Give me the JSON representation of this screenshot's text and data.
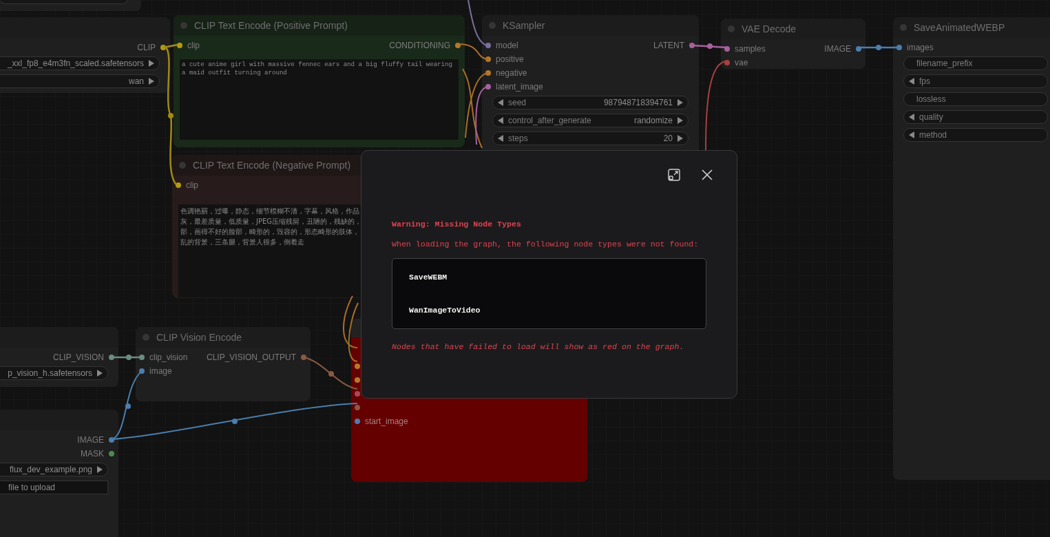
{
  "canvas": {
    "nodes": [
      {
        "kind": "default",
        "outputs": [
          {
            "label": "CLIP",
            "color": "#b49a12"
          }
        ],
        "widgets": [
          {
            "kind": "combo",
            "value": "_xxl_fp8_e4m3fn_scaled.safetensors"
          },
          {
            "kind": "combo",
            "value": "wan"
          }
        ]
      },
      {
        "kind": "positive",
        "title": "CLIP Text Encode (Positive Prompt)",
        "inputs": [
          {
            "label": "clip",
            "color": "#b49a12"
          }
        ],
        "outputs": [
          {
            "label": "CONDITIONING",
            "color": "#b8782a"
          }
        ],
        "prompt": "a cute anime girl with massive fennec ears and a big fluffy tail wearing a maid outfit turning around"
      },
      {
        "kind": "negative",
        "title": "CLIP Text Encode (Negative Prompt)",
        "inputs": [
          {
            "label": "clip",
            "color": "#b49a12"
          }
        ],
        "prompt_lines": [
          "色调艳丽，过曝，静态，细节模糊不清，字幕，风格，作品",
          "灰，最差质量，低质量，JPEG压缩残留，丑陋的，残缺的，",
          "部，画得不好的脸部，畸形的，毁容的，形态畸形的肢体，",
          "乱的背景，三条腿，背景人很多，倒着走"
        ]
      },
      {
        "kind": "default",
        "title": "KSampler",
        "inputs": [
          {
            "label": "model",
            "color": "#7a6f9c"
          },
          {
            "label": "positive",
            "color": "#b8782a"
          },
          {
            "label": "negative",
            "color": "#b8782a"
          },
          {
            "label": "latent_image",
            "color": "#a8609e"
          }
        ],
        "outputs": [
          {
            "label": "LATENT",
            "color": "#a8609e"
          }
        ],
        "widgets": [
          {
            "kind": "number",
            "label": "seed",
            "value": "987948718394761"
          },
          {
            "kind": "combo",
            "label": "control_after_generate",
            "value": "randomize"
          },
          {
            "kind": "number",
            "label": "steps",
            "value": "20"
          }
        ]
      },
      {
        "kind": "default",
        "title": "VAE Decode",
        "inputs": [
          {
            "label": "samples",
            "color": "#a8609e"
          },
          {
            "label": "vae",
            "color": "#a84040"
          }
        ],
        "outputs": [
          {
            "label": "IMAGE",
            "color": "#4a7eae"
          }
        ]
      },
      {
        "kind": "default",
        "title": "SaveAnimatedWEBP",
        "inputs": [
          {
            "label": "images",
            "color": "#4a7eae"
          }
        ],
        "widgets": [
          {
            "kind": "text",
            "label": "filename_prefix"
          },
          {
            "kind": "number",
            "label": "fps"
          },
          {
            "kind": "toggle",
            "label": "lossless"
          },
          {
            "kind": "number",
            "label": "quality"
          },
          {
            "kind": "combo",
            "label": "method"
          }
        ]
      },
      {
        "kind": "default",
        "outputs": [
          {
            "label": "CLIP_VISION",
            "color": "#6a8c82"
          }
        ],
        "widgets": [
          {
            "kind": "combo",
            "value": "p_vision_h.safetensors"
          }
        ]
      },
      {
        "kind": "default",
        "title": "CLIP Vision Encode",
        "inputs": [
          {
            "label": "clip_vision",
            "color": "#6a8c82"
          },
          {
            "label": "image",
            "color": "#4a7eae"
          }
        ],
        "outputs": [
          {
            "label": "CLIP_VISION_OUTPUT",
            "color": "#8a5a42"
          }
        ]
      },
      {
        "kind": "default",
        "outputs": [
          {
            "label": "IMAGE",
            "color": "#4a7eae"
          },
          {
            "label": "MASK",
            "color": "#4e8a4e"
          }
        ],
        "widgets": [
          {
            "kind": "combo",
            "value": "flux_dev_example.png"
          },
          {
            "kind": "button",
            "value": "file to upload"
          }
        ]
      },
      {
        "kind": "missing",
        "inputs": [
          {
            "color": "#b8782a"
          },
          {
            "color": "#b8782a"
          },
          {
            "color": "#a84858"
          },
          {
            "color": "#8a5a42"
          },
          {
            "label": "start_image",
            "color": "#4a7eae"
          }
        ]
      }
    ]
  },
  "dialog": {
    "title": "Warning: Missing Node Types",
    "message": "When loading the graph, the following node types were not found:",
    "missing_types": [
      "SaveWEBM",
      "WanImageToVideo"
    ],
    "note": "Nodes that have failed to load will show as red on the graph."
  }
}
